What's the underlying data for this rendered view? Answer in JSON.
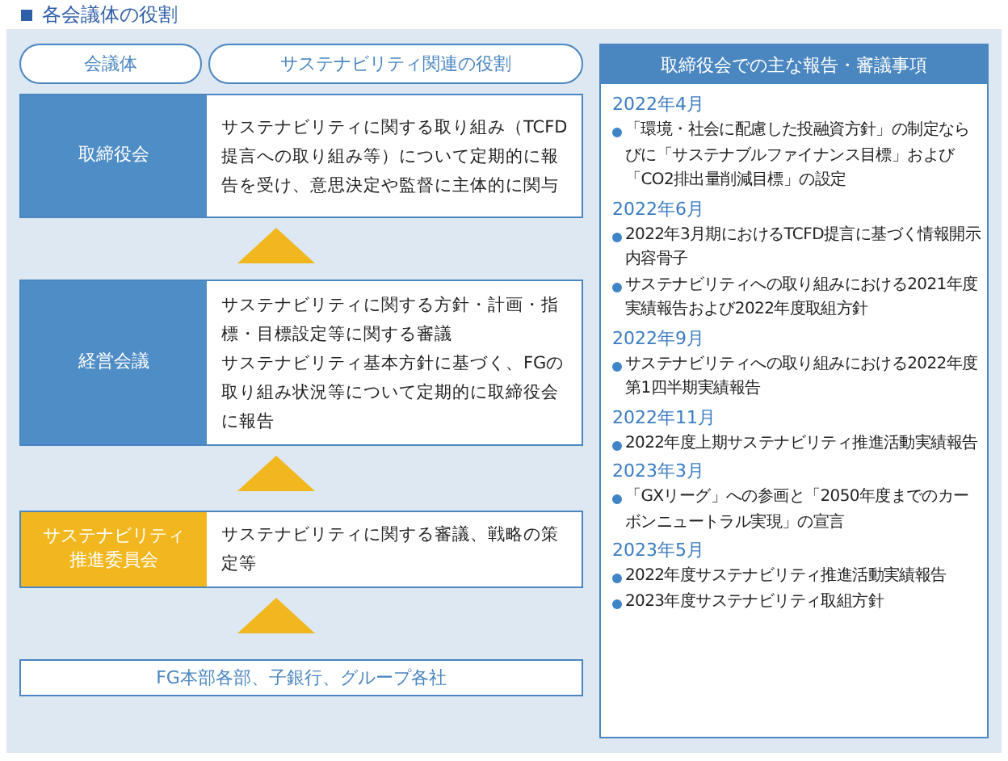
{
  "title": "各会議体の役割",
  "column_headers": [
    "会議体",
    "サステナビリティ関連の役割"
  ],
  "bodies": [
    {
      "kind": "board",
      "name": [
        "取締役会"
      ],
      "paragraphs": [
        "サステナビリティに関する取り組み（TCFD提言への取り組み等）について定期的に報告を受け、意思決定や監督に主体的に関与"
      ]
    },
    {
      "kind": "board",
      "name": [
        "経営会議"
      ],
      "paragraphs": [
        "サステナビリティに関する方針・計画・指標・目標設定等に関する審議",
        "サステナビリティ基本方針に基づく、FGの取り組み状況等について定期的に取締役会に報告"
      ]
    },
    {
      "kind": "committee",
      "name": [
        "サステナビリティ",
        "推進委員会"
      ],
      "paragraphs": [
        "サステナビリティに関する審議、戦略の策定等"
      ]
    }
  ],
  "base": "FG本部各部、子銀行、グループ各社",
  "reports": {
    "title": "取締役会での主な報告・審議事項",
    "groups": [
      {
        "date": "2022年4月",
        "items": [
          "「環境・社会に配慮した投融資方針」の制定ならびに「サステナブルファイナンス目標」および「CO2排出量削減目標」の設定"
        ]
      },
      {
        "date": "2022年6月",
        "items": [
          "2022年3月期におけるTCFD提言に基づく情報開示内容骨子",
          "サステナビリティへの取り組みにおける2021年度実績報告および2022年度取組方針"
        ]
      },
      {
        "date": "2022年9月",
        "items": [
          "サステナビリティへの取り組みにおける2022年度第1四半期実績報告"
        ]
      },
      {
        "date": "2022年11月",
        "items": [
          "2022年度上期サステナビリティ推進活動実績報告"
        ]
      },
      {
        "date": "2023年3月",
        "items": [
          "「GXリーグ」への参画と「2050年度までのカーボンニュートラル実現」の宣言"
        ]
      },
      {
        "date": "2023年5月",
        "items": [
          "2022年度サステナビリティ推進活動実績報告",
          "2023年度サステナビリティ取組方針"
        ]
      }
    ]
  }
}
